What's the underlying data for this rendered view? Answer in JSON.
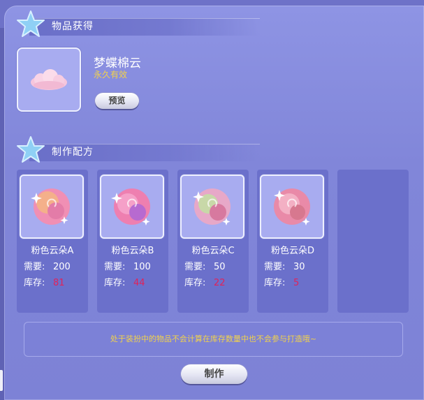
{
  "obtain": {
    "title": "物品获得"
  },
  "item": {
    "name": "梦蝶棉云",
    "duration": "永久有效",
    "preview_label": "预览"
  },
  "recipe": {
    "title": "制作配方",
    "materials": [
      {
        "name": "粉色云朵A",
        "need_label": "需要:",
        "need": "200",
        "stock_label": "库存:",
        "stock": "81"
      },
      {
        "name": "粉色云朵B",
        "need_label": "需要:",
        "need": "100",
        "stock_label": "库存:",
        "stock": "44"
      },
      {
        "name": "粉色云朵C",
        "need_label": "需要:",
        "need": "50",
        "stock_label": "库存:",
        "stock": "22"
      },
      {
        "name": "粉色云朵D",
        "need_label": "需要:",
        "need": "30",
        "stock_label": "库存:",
        "stock": "5"
      }
    ]
  },
  "notice": "处于装扮中的物品不会计算在库存数量中也不会参与打造哦~",
  "make_label": "制作",
  "colors": {
    "stock": "#e0225a",
    "duration": "#f2d24a",
    "accent_star": "#8fd0f5"
  }
}
